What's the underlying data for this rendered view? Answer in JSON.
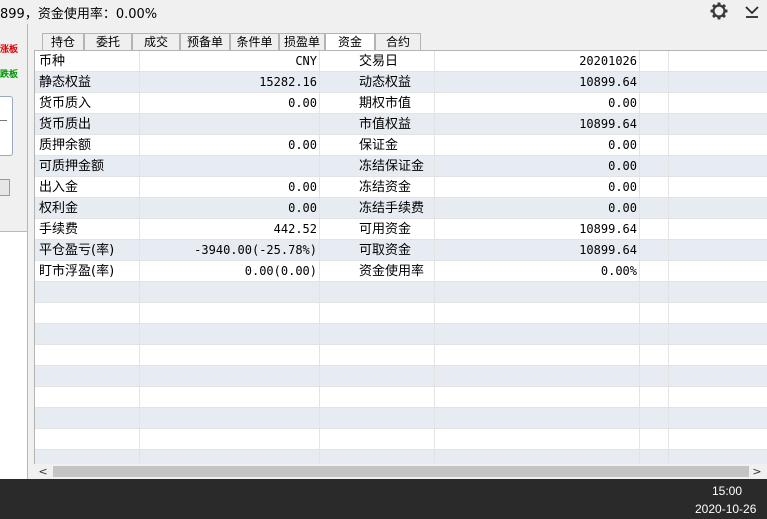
{
  "top_bar": {
    "status_text": "899，资金使用率：0.00%",
    "settings_icon": "gear-icon",
    "collapse_icon": "chevron-down-icon"
  },
  "left_panel": {
    "red_label": "涨板",
    "green_label": "跌板"
  },
  "tabs": [
    {
      "label": "持仓",
      "active": false
    },
    {
      "label": "委托",
      "active": false
    },
    {
      "label": "成交",
      "active": false
    },
    {
      "label": "预备单",
      "active": false
    },
    {
      "label": "条件单",
      "active": false
    },
    {
      "label": "损盈单",
      "active": false
    },
    {
      "label": "资金",
      "active": true
    },
    {
      "label": "合约",
      "active": false
    }
  ],
  "fund_rows": [
    {
      "label1": "币种",
      "value1": "CNY",
      "label2": "交易日",
      "value2": "20201026"
    },
    {
      "label1": "静态权益",
      "value1": "15282.16",
      "label2": "动态权益",
      "value2": "10899.64"
    },
    {
      "label1": "货币质入",
      "value1": "0.00",
      "label2": "期权市值",
      "value2": "0.00"
    },
    {
      "label1": "货币质出",
      "value1": "",
      "label2": "市值权益",
      "value2": "10899.64"
    },
    {
      "label1": "质押余额",
      "value1": "0.00",
      "label2": "保证金",
      "value2": "0.00"
    },
    {
      "label1": "可质押金额",
      "value1": "",
      "label2": "冻结保证金",
      "value2": "0.00"
    },
    {
      "label1": "出入金",
      "value1": "0.00",
      "label2": "冻结资金",
      "value2": "0.00"
    },
    {
      "label1": "权利金",
      "value1": "0.00",
      "label2": "冻结手续费",
      "value2": "0.00"
    },
    {
      "label1": "手续费",
      "value1": "442.52",
      "label2": "可用资金",
      "value2": "10899.64"
    },
    {
      "label1": "平仓盈亏(率)",
      "value1": "-3940.00(-25.78%)",
      "label2": "可取资金",
      "value2": "10899.64"
    },
    {
      "label1": "盯市浮盈(率)",
      "value1": "0.00(0.00)",
      "label2": "资金使用率",
      "value2": "0.00%"
    }
  ],
  "scrollbar": {
    "left_arrow": "<",
    "right_arrow": ">"
  },
  "taskbar": {
    "time": "15:00",
    "date": "2020-10-26"
  },
  "colors": {
    "row_stripe": "#e7ebf2",
    "grid_line": "#e3e3e3",
    "limit_up": "#e00000",
    "limit_down": "#009600",
    "taskbar_bg": "#2a2a2a"
  }
}
